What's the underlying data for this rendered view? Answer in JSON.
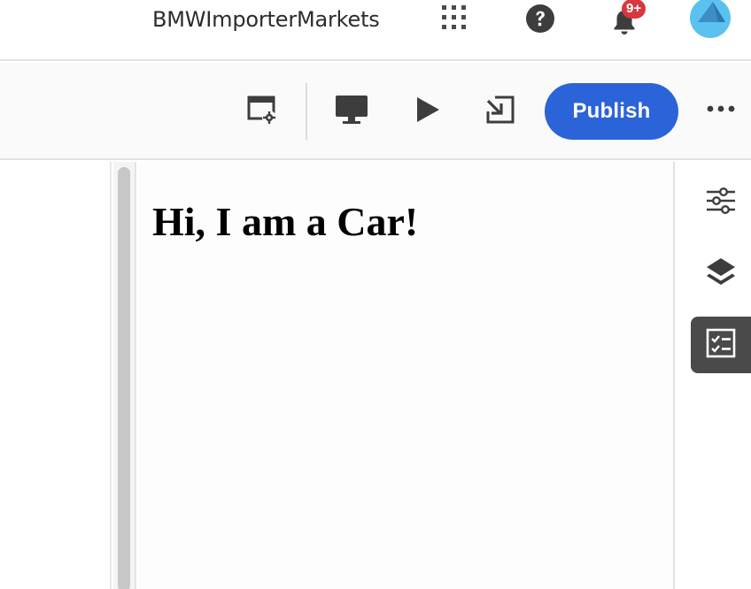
{
  "shell": {
    "org_name": "BMWImporterMarkets",
    "notification_count": "9+",
    "icons": [
      "apps-grid-icon",
      "help-icon",
      "bell-icon",
      "avatar"
    ]
  },
  "toolbar": {
    "icons": [
      "page-properties-icon",
      "desktop-preview-icon",
      "play-icon",
      "open-external-icon",
      "more-icon"
    ],
    "publish_label": "Publish"
  },
  "canvas": {
    "heading": "Hi, I am a Car!"
  },
  "right_rail": {
    "icons": [
      "properties-sliders-icon",
      "layers-icon",
      "checklist-icon"
    ],
    "active": "checklist-icon"
  },
  "colors": {
    "accent": "#2b63d9",
    "badge": "#d7373f",
    "active_rail": "#4a4a4a",
    "avatar": "#5bc2f0"
  }
}
